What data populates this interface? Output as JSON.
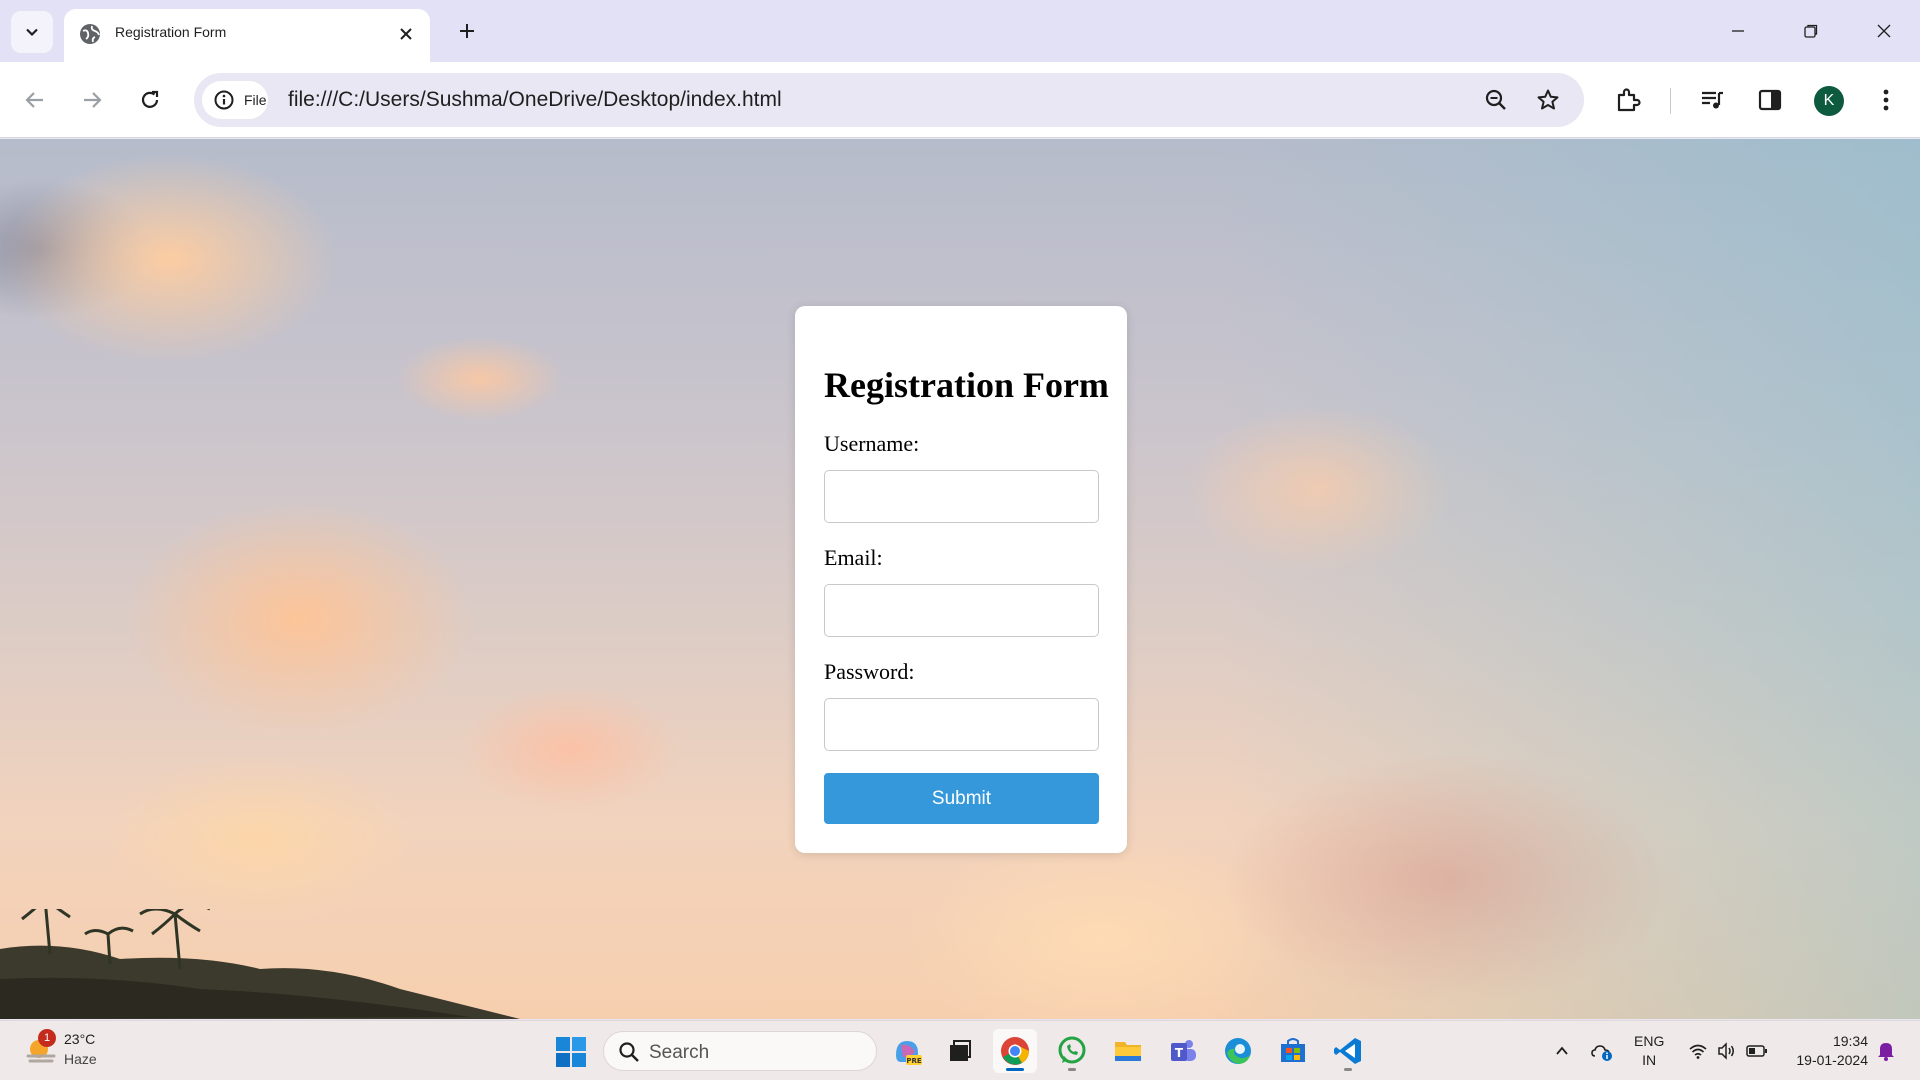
{
  "browser": {
    "tab": {
      "title": "Registration Form",
      "favicon": "globe-icon"
    },
    "site_chip": "File",
    "url": "file:///C:/Users/Sushma/OneDrive/Desktop/index.html",
    "profile_initial": "K"
  },
  "form": {
    "title": "Registration Form",
    "fields": [
      {
        "label": "Username:",
        "value": ""
      },
      {
        "label": "Email:",
        "value": ""
      },
      {
        "label": "Password:",
        "value": ""
      }
    ],
    "submit_label": "Submit",
    "accent_color": "#3498db"
  },
  "taskbar": {
    "weather": {
      "temp": "23°C",
      "condition": "Haze",
      "badge": "1"
    },
    "search_placeholder": "Search",
    "apps": [
      "copilot-pre-icon",
      "task-view-icon",
      "chrome-icon",
      "whatsapp-icon",
      "file-explorer-icon",
      "teams-icon",
      "edge-icon",
      "store-icon",
      "vscode-icon"
    ],
    "language": {
      "line1": "ENG",
      "line2": "IN"
    },
    "time": "19:34",
    "date": "19-01-2024"
  }
}
